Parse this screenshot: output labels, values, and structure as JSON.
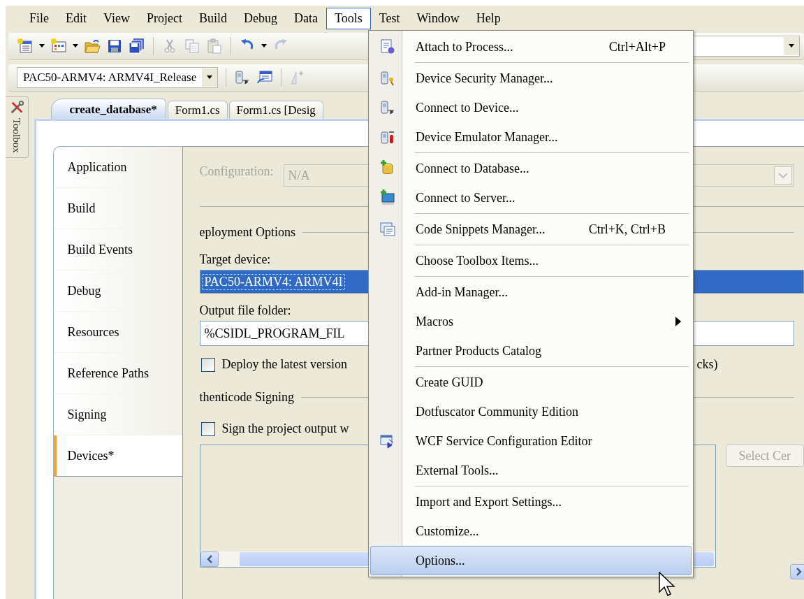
{
  "menu_bar": [
    {
      "label": "File",
      "selected": false
    },
    {
      "label": "Edit",
      "selected": false
    },
    {
      "label": "View",
      "selected": false
    },
    {
      "label": "Project",
      "selected": false
    },
    {
      "label": "Build",
      "selected": false
    },
    {
      "label": "Debug",
      "selected": false
    },
    {
      "label": "Data",
      "selected": false
    },
    {
      "label": "Tools",
      "selected": true
    },
    {
      "label": "Test",
      "selected": false
    },
    {
      "label": "Window",
      "selected": false
    },
    {
      "label": "Help",
      "selected": false
    }
  ],
  "configuration_toolbar": {
    "configuration": "PAC50-ARMV4: ARMV4I_Release"
  },
  "toolbox": {
    "label": "Toolbox"
  },
  "doc_tabs": [
    {
      "label": "create_database*",
      "selected": true
    },
    {
      "label": "Form1.cs",
      "selected": false
    },
    {
      "label": "Form1.cs [Desig",
      "selected": false
    }
  ],
  "nav": [
    {
      "label": "Application",
      "selected": false
    },
    {
      "label": "Build",
      "selected": false
    },
    {
      "label": "Build Events",
      "selected": false
    },
    {
      "label": "Debug",
      "selected": false
    },
    {
      "label": "Resources",
      "selected": false
    },
    {
      "label": "Reference Paths",
      "selected": false
    },
    {
      "label": "Signing",
      "selected": false
    },
    {
      "label": "Devices*",
      "selected": true
    }
  ],
  "devices_page": {
    "configuration": {
      "label": "Configuration:",
      "value": "N/A",
      "disabled": true
    },
    "deployment_heading": "eployment Options",
    "target_device": {
      "label": "Target device:",
      "value": "PAC50-ARMV4: ARMV4I",
      "selected": true
    },
    "output_folder": {
      "label": "Output file folder:",
      "value": "%CSIDL_PROGRAM_FIL"
    },
    "deploy_latest": {
      "label": "Deploy the latest version",
      "label_tail": "cks)",
      "checked": false
    },
    "signing_heading": "thenticode Signing",
    "sign_output": {
      "label": "Sign the project output w",
      "checked": false
    },
    "select_button": {
      "label": "Select Cer",
      "disabled": true
    }
  },
  "tools_menu": [
    {
      "kind": "item",
      "label": "Attach to Process...",
      "shortcut": "Ctrl+Alt+P",
      "selected": false
    },
    {
      "kind": "separator"
    },
    {
      "kind": "item",
      "label": "Device Security Manager...",
      "selected": false
    },
    {
      "kind": "item",
      "label": "Connect to Device...",
      "selected": false
    },
    {
      "kind": "item",
      "label": "Device Emulator Manager...",
      "selected": false
    },
    {
      "kind": "separator"
    },
    {
      "kind": "item",
      "label": "Connect to Database...",
      "selected": false
    },
    {
      "kind": "item",
      "label": "Connect to Server...",
      "selected": false
    },
    {
      "kind": "separator"
    },
    {
      "kind": "item",
      "label": "Code Snippets Manager...",
      "shortcut": "Ctrl+K, Ctrl+B",
      "selected": false
    },
    {
      "kind": "separator"
    },
    {
      "kind": "item",
      "label": "Choose Toolbox Items...",
      "selected": false
    },
    {
      "kind": "separator"
    },
    {
      "kind": "item",
      "label": "Add-in Manager...",
      "selected": false
    },
    {
      "kind": "item",
      "label": "Macros",
      "submenu": true,
      "selected": false
    },
    {
      "kind": "item",
      "label": "Partner Products Catalog",
      "selected": false
    },
    {
      "kind": "separator"
    },
    {
      "kind": "item",
      "label": "Create GUID",
      "selected": false
    },
    {
      "kind": "item",
      "label": "Dotfuscator Community Edition",
      "selected": false
    },
    {
      "kind": "item",
      "label": "WCF Service Configuration Editor",
      "selected": false
    },
    {
      "kind": "item",
      "label": "External Tools...",
      "selected": false
    },
    {
      "kind": "separator"
    },
    {
      "kind": "item",
      "label": "Import and Export Settings...",
      "selected": false
    },
    {
      "kind": "item",
      "label": "Customize...",
      "selected": false
    },
    {
      "kind": "item",
      "label": "Options...",
      "selected": true
    }
  ]
}
